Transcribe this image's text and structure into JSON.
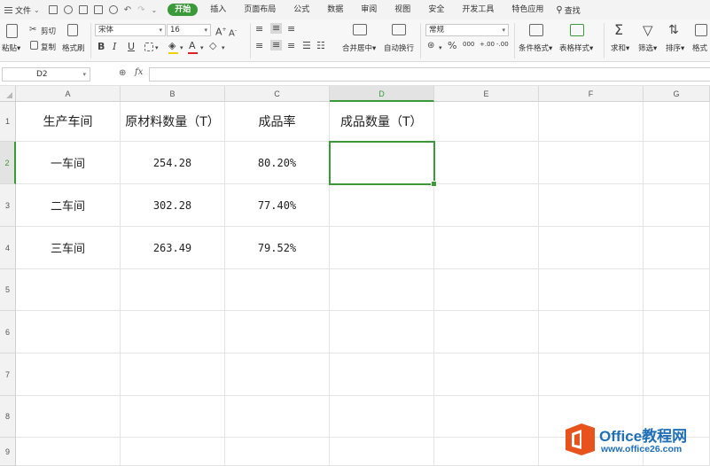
{
  "menubar": {
    "file_label": "文件",
    "tabs": [
      {
        "label": "开始",
        "active": true
      },
      {
        "label": "插入"
      },
      {
        "label": "页面布局"
      },
      {
        "label": "公式"
      },
      {
        "label": "数据"
      },
      {
        "label": "审阅"
      },
      {
        "label": "视图"
      },
      {
        "label": "安全"
      },
      {
        "label": "开发工具"
      },
      {
        "label": "特色应用"
      }
    ],
    "search_label": "查找"
  },
  "ribbon": {
    "paste_label": "粘贴",
    "cut_label": "剪切",
    "copy_label": "复制",
    "format_painter_label": "格式刷",
    "font_name": "宋体",
    "font_size": "16",
    "bold": "B",
    "italic": "I",
    "underline": "U",
    "font_grow": "A",
    "font_shrink": "A",
    "font_color_letter": "A",
    "merge_label": "合并居中",
    "wrap_label": "自动换行",
    "number_format": "常规",
    "percent": "%",
    "thousands": "000",
    "dec_inc": ".00",
    "dec_dec": ".00",
    "cond_format_label": "条件格式",
    "table_style_label": "表格样式",
    "sum_label": "求和",
    "filter_label": "筛选",
    "sort_label": "排序",
    "format_label": "格式",
    "colors": {
      "fill": "#f4d000",
      "font": "#e02020",
      "accent": "#3a9a3a"
    }
  },
  "formula_bar": {
    "cell_ref": "D2",
    "fx_label": "fx",
    "value": ""
  },
  "sheet": {
    "columns": [
      "A",
      "B",
      "C",
      "D",
      "E",
      "F",
      "G"
    ],
    "selected_column": "D",
    "rows": [
      "1",
      "2",
      "3",
      "4",
      "5",
      "6",
      "7",
      "8",
      "9"
    ],
    "selected_row": "2",
    "headers": [
      "生产车间",
      "原材料数量（T）",
      "成品率",
      "成品数量（T）"
    ],
    "data": [
      {
        "workshop": "一车间",
        "material": "254.28",
        "yield": "80.20%",
        "product": ""
      },
      {
        "workshop": "二车间",
        "material": "302.28",
        "yield": "77.40%",
        "product": ""
      },
      {
        "workshop": "三车间",
        "material": "263.49",
        "yield": "79.52%",
        "product": ""
      }
    ],
    "active_cell": "D2"
  },
  "watermark": {
    "title": "Office教程网",
    "url": "www.office26.com",
    "logo_color": "#e8531d"
  }
}
